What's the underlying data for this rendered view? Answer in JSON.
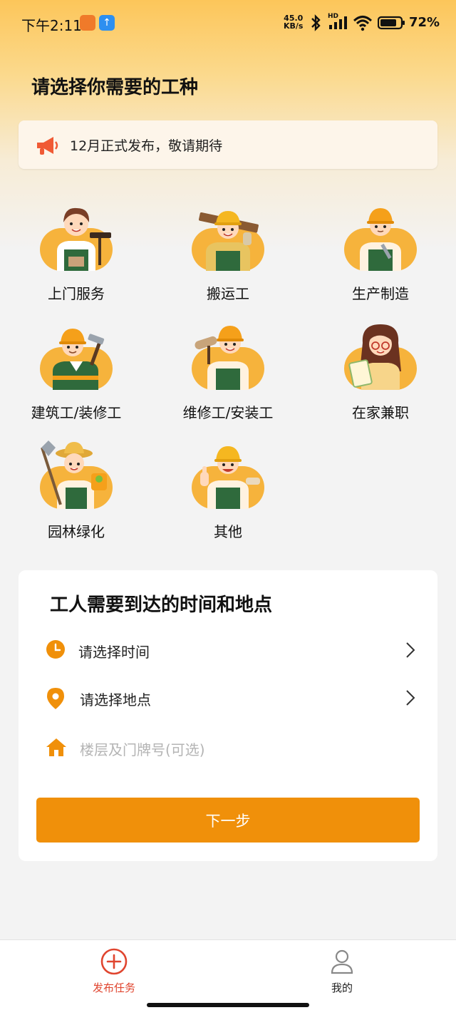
{
  "status_bar": {
    "time": "下午2:11",
    "net_speed_value": "45.0",
    "net_speed_unit": "KB/s",
    "signal_label": "HD",
    "battery": "72%"
  },
  "header": {
    "title": "请选择你需要的工种"
  },
  "notice": {
    "icon": "megaphone-icon",
    "text": "12月正式发布，敬请期待"
  },
  "categories": [
    {
      "label": "上门服务"
    },
    {
      "label": "搬运工"
    },
    {
      "label": "生产制造"
    },
    {
      "label": "建筑工/装修工"
    },
    {
      "label": "维修工/安装工"
    },
    {
      "label": "在家兼职"
    },
    {
      "label": "园林绿化"
    },
    {
      "label": "其他"
    }
  ],
  "schedule": {
    "title": "工人需要到达的时间和地点",
    "time_label": "请选择时间",
    "location_label": "请选择地点",
    "room_placeholder": "楼层及门牌号(可选)",
    "next_button": "下一步"
  },
  "tabs": {
    "publish": "发布任务",
    "mine": "我的"
  },
  "colors": {
    "accent": "#f0900a",
    "active_tab": "#e0452f",
    "header_gradient_top": "#fcc65a"
  }
}
